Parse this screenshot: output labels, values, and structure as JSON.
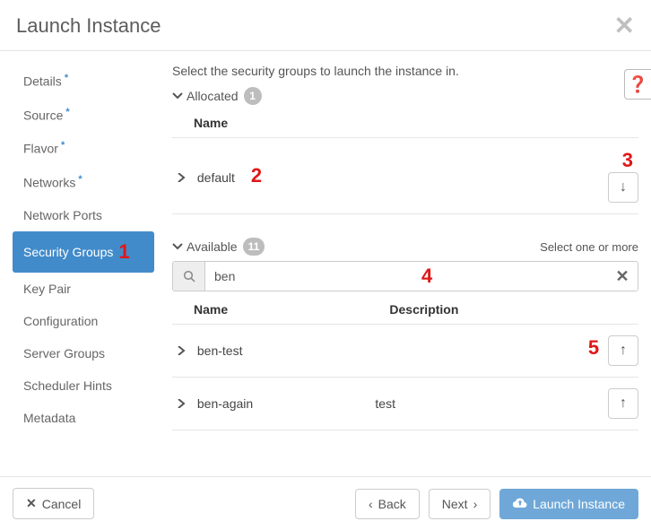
{
  "header": {
    "title": "Launch Instance"
  },
  "sidebar": {
    "items": [
      {
        "label": "Details",
        "required": true,
        "active": false
      },
      {
        "label": "Source",
        "required": true,
        "active": false
      },
      {
        "label": "Flavor",
        "required": true,
        "active": false
      },
      {
        "label": "Networks",
        "required": true,
        "active": false
      },
      {
        "label": "Network Ports",
        "required": false,
        "active": false
      },
      {
        "label": "Security Groups",
        "required": false,
        "active": true
      },
      {
        "label": "Key Pair",
        "required": false,
        "active": false
      },
      {
        "label": "Configuration",
        "required": false,
        "active": false
      },
      {
        "label": "Server Groups",
        "required": false,
        "active": false
      },
      {
        "label": "Scheduler Hints",
        "required": false,
        "active": false
      },
      {
        "label": "Metadata",
        "required": false,
        "active": false
      }
    ]
  },
  "main": {
    "instruction": "Select the security groups to launch the instance in.",
    "allocated": {
      "label": "Allocated",
      "count": "1",
      "columns": {
        "name": "Name"
      },
      "rows": [
        {
          "name": "default"
        }
      ]
    },
    "available": {
      "label": "Available",
      "count": "11",
      "select_hint": "Select one or more",
      "search_value": "ben",
      "columns": {
        "name": "Name",
        "description": "Description"
      },
      "rows": [
        {
          "name": "ben-test",
          "description": ""
        },
        {
          "name": "ben-again",
          "description": "test"
        }
      ]
    }
  },
  "footer": {
    "cancel": "Cancel",
    "back": "Back",
    "next": "Next",
    "launch": "Launch Instance"
  },
  "annotations": {
    "a1": "1",
    "a2": "2",
    "a3": "3",
    "a4": "4",
    "a5": "5"
  }
}
